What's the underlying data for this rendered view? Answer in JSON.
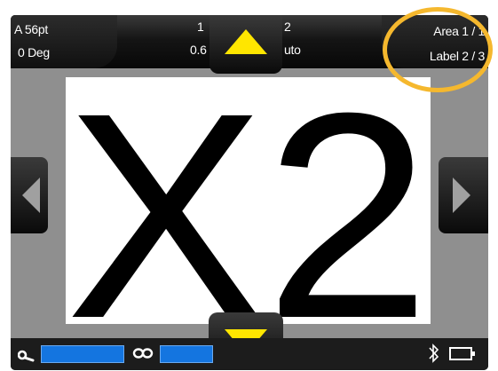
{
  "status": {
    "font_size": "A 56pt",
    "rotation": "0 Deg",
    "mid_top_a": "1",
    "mid_top_b": "2",
    "mid_bottom_a": "0.6",
    "mid_bottom_b": "uto",
    "area": "Area 1 / 1",
    "label": "Label 2 / 3"
  },
  "label_content": {
    "text": "X2"
  },
  "navigation": {
    "up_icon": "triangle-up",
    "down_icon": "triangle-down",
    "left_icon": "triangle-left",
    "right_icon": "triangle-right",
    "arrow_color": "#ffe600"
  },
  "footer": {
    "icons": [
      "magnifier-icon",
      "link-icon",
      "bluetooth-icon",
      "battery-icon"
    ],
    "bar_color": "#1475e0"
  },
  "highlight_color": "#f5b82e"
}
